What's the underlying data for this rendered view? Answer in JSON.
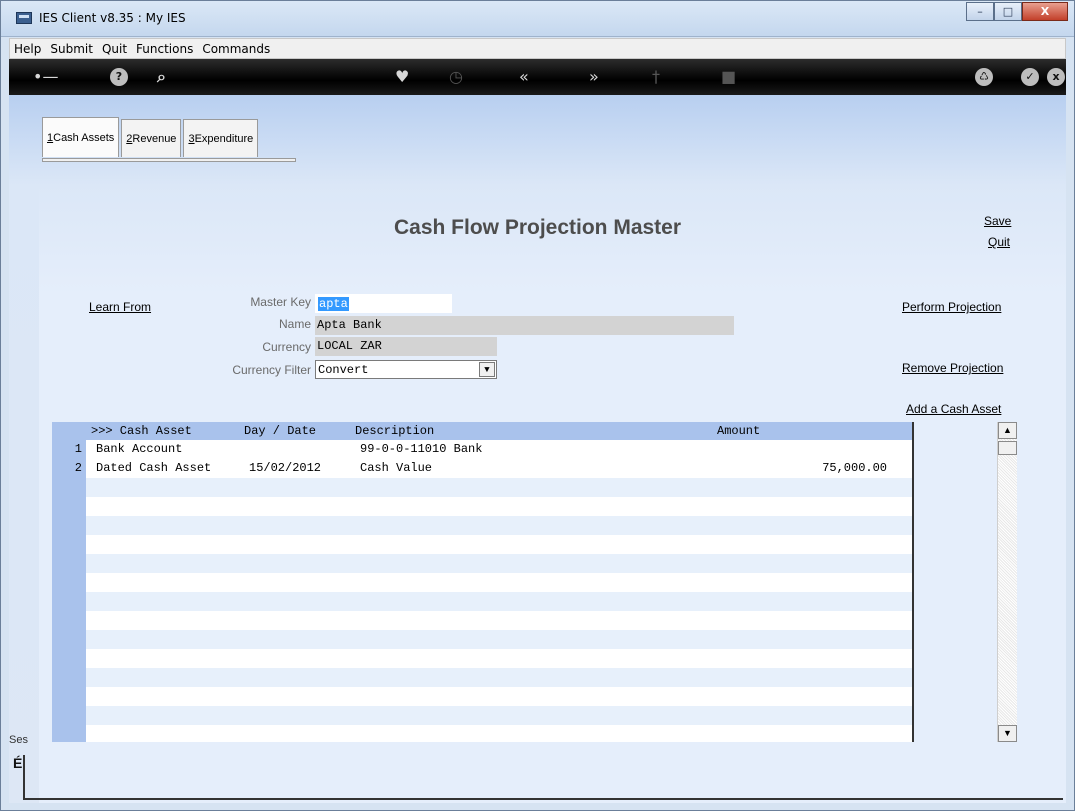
{
  "window": {
    "title": "IES Client v8.35 : My IES"
  },
  "menu": {
    "items": [
      "Help",
      "Submit",
      "Quit",
      "Functions",
      "Commands"
    ]
  },
  "tabs": [
    {
      "num": "1",
      "label": " Cash Assets"
    },
    {
      "num": "2",
      "label": " Revenue"
    },
    {
      "num": "3",
      "label": " Expenditure"
    }
  ],
  "page": {
    "title": "Cash Flow Projection Master"
  },
  "links": {
    "save": "Save",
    "quit": "Quit",
    "learn_from": "Learn From",
    "perform_projection": "Perform Projection",
    "remove_projection": "Remove Projection",
    "add_cash_asset": "Add a Cash Asset"
  },
  "form": {
    "master_key_label": "Master Key",
    "master_key_value": "apta",
    "name_label": "Name",
    "name_value": "Apta Bank",
    "currency_label": "Currency",
    "currency_value": "LOCAL ZAR",
    "currency_filter_label": "Currency Filter",
    "currency_filter_value": "Convert"
  },
  "grid": {
    "headers": [
      ">>> Cash Asset",
      "Day / Date",
      "Description",
      "Amount"
    ],
    "rows": [
      {
        "num": "1",
        "asset": "Bank Account",
        "date": "",
        "desc": "99-0-0-11010 Bank",
        "amount": ""
      },
      {
        "num": "2",
        "asset": "Dated Cash Asset",
        "date": "15/02/2012",
        "desc": "Cash Value",
        "amount": "75,000.00"
      }
    ]
  },
  "status": {
    "label": "Ses"
  },
  "icons": {
    "toolbar": [
      "key-icon",
      "help-icon",
      "search-icon",
      "heart-icon",
      "clock-icon",
      "rewind-icon",
      "forward-icon",
      "pin-icon",
      "stop-icon",
      "recycle-icon",
      "check-icon",
      "close-icon"
    ]
  }
}
